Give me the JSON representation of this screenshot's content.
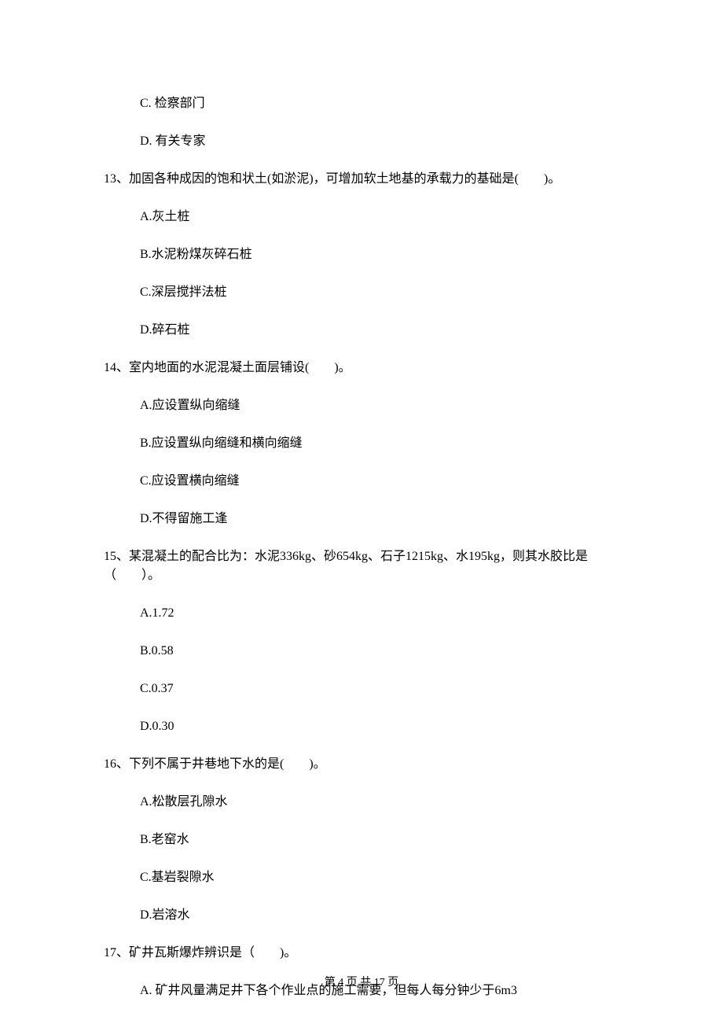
{
  "prev_options": {
    "c": "C. 检察部门",
    "d": "D. 有关专家"
  },
  "q13": {
    "text": "13、加固各种成因的饱和状土(如淤泥)，可增加软土地基的承载力的基础是(　　)。",
    "a": "A.灰土桩",
    "b": "B.水泥粉煤灰碎石桩",
    "c": "C.深层搅拌法桩",
    "d": "D.碎石桩"
  },
  "q14": {
    "text": "14、室内地面的水泥混凝土面层铺设(　　)。",
    "a": "A.应设置纵向缩缝",
    "b": "B.应设置纵向缩缝和横向缩缝",
    "c": "C.应设置横向缩缝",
    "d": "D.不得留施工逢"
  },
  "q15": {
    "text": "15、某混凝土的配合比为：水泥336kg、砂654kg、石子1215kg、水195kg，则其水胶比是（　　）。",
    "a": "A.1.72",
    "b": "B.0.58",
    "c": "C.0.37",
    "d": "D.0.30"
  },
  "q16": {
    "text": "16、下列不属于井巷地下水的是(　　)。",
    "a": "A.松散层孔隙水",
    "b": "B.老窑水",
    "c": "C.基岩裂隙水",
    "d": "D.岩溶水"
  },
  "q17": {
    "text": "17、矿井瓦斯爆炸辨识是（　　)。",
    "a": "A. 矿井风量满足井下各个作业点的施工需要，但每人每分钟少于6m3"
  },
  "footer": "第 4 页 共 17 页"
}
